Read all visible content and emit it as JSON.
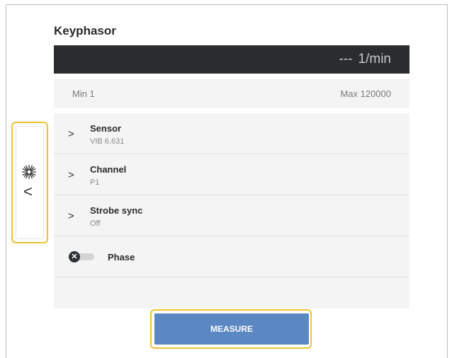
{
  "page": {
    "title": "Keyphasor"
  },
  "display": {
    "value": "---",
    "unit": "1/min"
  },
  "range": {
    "min": "Min 1",
    "max": "Max 120000"
  },
  "settings": [
    {
      "label": "Sensor",
      "value": "VIB 6.631"
    },
    {
      "label": "Channel",
      "value": "P1"
    },
    {
      "label": "Strobe sync",
      "value": "Off"
    }
  ],
  "phase": {
    "label": "Phase",
    "enabled": false
  },
  "side_panel": {
    "icons": [
      "strobe-icon",
      "back-arrow-icon"
    ]
  },
  "actions": {
    "measure_label": "MEASURE"
  },
  "colors": {
    "display_bg": "#2a2d30",
    "highlight": "#f1c232",
    "button": "#5b87c2",
    "panel_bg": "#f4f4f4"
  }
}
